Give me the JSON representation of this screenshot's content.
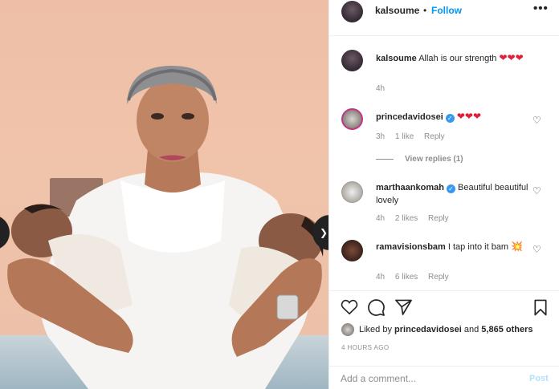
{
  "post": {
    "username": "kalsoume",
    "separator": "•",
    "follow_label": "Follow",
    "more_icon": "more-horizontal-icon",
    "caption": {
      "username": "kalsoume",
      "text": "Allah is our strength",
      "emoji": "❤❤❤",
      "time": "4h"
    }
  },
  "comments": [
    {
      "username": "princedavidosei",
      "verified": true,
      "text": "",
      "emoji": "❤❤❤",
      "time": "3h",
      "likes": "1 like",
      "reply_label": "Reply"
    },
    {
      "username": "marthaankomah",
      "verified": true,
      "text": "Beautiful beautiful lovely",
      "time": "4h",
      "likes": "2 likes",
      "reply_label": "Reply"
    },
    {
      "username": "ramavisionsbam",
      "verified": false,
      "text": "I tap into it bam",
      "emoji": "💥",
      "time": "4h",
      "likes": "6 likes",
      "reply_label": "Reply"
    }
  ],
  "view_replies": "View replies (1)",
  "actions": {
    "like_icon": "heart-icon",
    "comment_icon": "comment-icon",
    "share_icon": "send-icon",
    "save_icon": "bookmark-icon"
  },
  "likes_line": {
    "prefix": "Liked by",
    "user": "princedavidosei",
    "and": "and",
    "others": "5,865 others"
  },
  "timestamp": "4 HOURS AGO",
  "comment_box": {
    "placeholder": "Add a comment...",
    "post_label": "Post"
  },
  "colors": {
    "link_blue": "#0095f6",
    "post_disabled": "#b2dffc",
    "muted": "#8e8e8e",
    "verified": "#3897f0"
  }
}
